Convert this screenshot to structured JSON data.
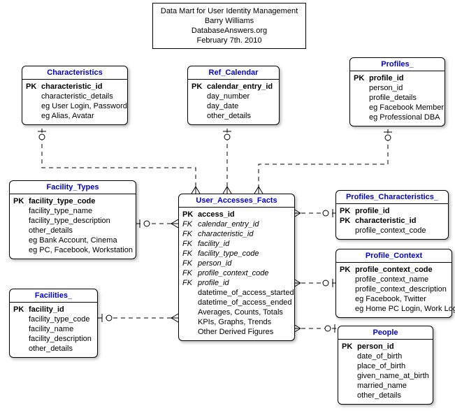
{
  "header": {
    "line1": "Data Mart for User Identity Management",
    "line2": "Barry Williams",
    "line3": "DatabaseAnswers.org",
    "line4": "February 7th. 2010"
  },
  "entities": {
    "characteristics": {
      "title": "Characteristics",
      "rows": [
        {
          "k": "PK",
          "t": "characteristic_id",
          "b": true
        },
        {
          "k": "",
          "t": "characteristic_details"
        },
        {
          "k": "",
          "t": "eg User Login, Password"
        },
        {
          "k": "",
          "t": "eg Alias, Avatar"
        }
      ]
    },
    "ref_calendar": {
      "title": "Ref_Calendar",
      "rows": [
        {
          "k": "PK",
          "t": "calendar_entry_id",
          "b": true
        },
        {
          "k": "",
          "t": "day_number"
        },
        {
          "k": "",
          "t": "day_date"
        },
        {
          "k": "",
          "t": "other_details"
        }
      ]
    },
    "profiles": {
      "title": "Profiles_",
      "rows": [
        {
          "k": "PK",
          "t": "profile_id",
          "b": true
        },
        {
          "k": "",
          "t": "person_id"
        },
        {
          "k": "",
          "t": "profile_details"
        },
        {
          "k": "",
          "t": "eg Facebook Member"
        },
        {
          "k": "",
          "t": "eg Professional DBA"
        }
      ]
    },
    "facility_types": {
      "title": "Facility_Types",
      "rows": [
        {
          "k": "PK",
          "t": "facility_type_code",
          "b": true
        },
        {
          "k": "",
          "t": "facility_type_name"
        },
        {
          "k": "",
          "t": "facility_type_description"
        },
        {
          "k": "",
          "t": "other_details"
        },
        {
          "k": "",
          "t": "eg Bank Account, Cinema"
        },
        {
          "k": "",
          "t": "eg PC, Facebook, Workstation"
        }
      ]
    },
    "user_accesses_facts": {
      "title": "User_Accesses_Facts",
      "rows": [
        {
          "k": "PK",
          "t": "access_id",
          "b": true
        },
        {
          "k": "FK",
          "t": "calendar_entry_id",
          "i": true
        },
        {
          "k": "FK",
          "t": "characteristic_id",
          "i": true
        },
        {
          "k": "FK",
          "t": "facility_id",
          "i": true
        },
        {
          "k": "FK",
          "t": "facility_type_code",
          "i": true
        },
        {
          "k": "FK",
          "t": "person_id",
          "i": true
        },
        {
          "k": "FK",
          "t": "profile_context_code",
          "i": true
        },
        {
          "k": "FK",
          "t": "profile_id",
          "i": true
        },
        {
          "k": "",
          "t": "datetime_of_access_started"
        },
        {
          "k": "",
          "t": "datetime_of_access_ended"
        },
        {
          "k": "",
          "t": "Averages, Counts, Totals"
        },
        {
          "k": "",
          "t": "KPIs, Graphs, Trends"
        },
        {
          "k": "",
          "t": "Other Derived Figures"
        }
      ]
    },
    "profiles_characteristics": {
      "title": "Profiles_Characteristics_",
      "rows": [
        {
          "k": "PK",
          "t": "profile_id",
          "b": true
        },
        {
          "k": "PK",
          "t": "characteristic_id",
          "b": true
        },
        {
          "k": "",
          "t": "profile_context_code"
        }
      ]
    },
    "profile_context": {
      "title": "Profile_Context",
      "rows": [
        {
          "k": "PK",
          "t": "profile_context_code",
          "b": true
        },
        {
          "k": "",
          "t": "profile_context_name"
        },
        {
          "k": "",
          "t": "profile_context_description"
        },
        {
          "k": "",
          "t": "eg Facebook, Twitter"
        },
        {
          "k": "",
          "t": "eg Home PC Login, Work Login"
        }
      ]
    },
    "people": {
      "title": "People",
      "rows": [
        {
          "k": "PK",
          "t": "person_id",
          "b": true
        },
        {
          "k": "",
          "t": "date_of_birth"
        },
        {
          "k": "",
          "t": "place_of_birth"
        },
        {
          "k": "",
          "t": "given_name_at_birth"
        },
        {
          "k": "",
          "t": "married_name"
        },
        {
          "k": "",
          "t": "other_details"
        }
      ]
    },
    "facilities": {
      "title": "Facilities_",
      "rows": [
        {
          "k": "PK",
          "t": "facility_id",
          "b": true
        },
        {
          "k": "",
          "t": "facility_type_code"
        },
        {
          "k": "",
          "t": "facility_name"
        },
        {
          "k": "",
          "t": "facility_description"
        },
        {
          "k": "",
          "t": "other_details"
        }
      ]
    }
  }
}
